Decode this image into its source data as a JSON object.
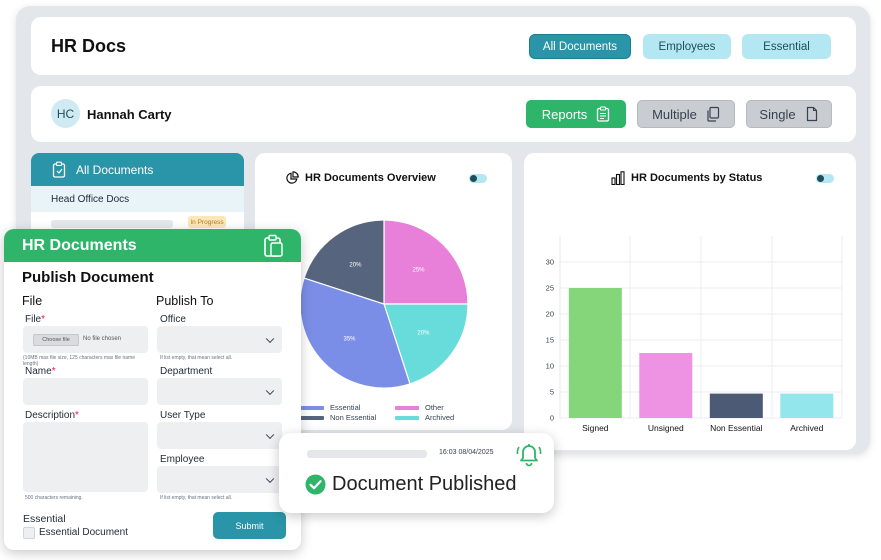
{
  "header": {
    "title": "HR Docs",
    "filters": [
      {
        "label": "All Documents",
        "active": true
      },
      {
        "label": "Employees",
        "active": false
      },
      {
        "label": "Essential",
        "active": false
      }
    ]
  },
  "user": {
    "initials": "HC",
    "name": "Hannah Carty",
    "buttons": {
      "reports": "Reports",
      "multiple": "Multiple",
      "single": "Single"
    }
  },
  "docs_panel": {
    "header": "All Documents",
    "item": "Head Office Docs",
    "badge": "In Progress"
  },
  "overview": {
    "title": "HR Documents Overview",
    "legend": [
      {
        "label": "Essential",
        "color": "#7a8ee8"
      },
      {
        "label": "Other",
        "color": "#e880da"
      },
      {
        "label": "Non Essential",
        "color": "#56647e"
      },
      {
        "label": "Archived",
        "color": "#68dcda"
      }
    ]
  },
  "status_chart": {
    "title": "HR Documents by Status"
  },
  "form": {
    "header": "HR Documents",
    "subtitle": "Publish Document",
    "file_heading": "File",
    "publish_heading": "Publish To",
    "file_label": "File",
    "choose_file": "Choose file",
    "no_file": "No file chosen",
    "file_hint": "(10MB max file size, 125 characters max file name length)",
    "name_label": "Name",
    "description_label": "Description",
    "desc_hint": "500 characters remaining.",
    "office_label": "Office",
    "office_hint": "If list empty, that mean select all.",
    "department_label": "Department",
    "user_type_label": "User Type",
    "employee_label": "Employee",
    "employee_hint": "If list empty, that mean select all.",
    "essential_label": "Essential",
    "essential_checkbox": "Essential Document",
    "submit": "Submit"
  },
  "toast": {
    "time": "16:03 08/04/2025",
    "message": "Document Published"
  },
  "chart_data": [
    {
      "type": "pie",
      "title": "HR Documents Overview",
      "categories": [
        "Other",
        "Archived",
        "Essential",
        "Non Essential"
      ],
      "values": [
        25,
        20,
        35,
        20
      ],
      "labels": [
        "25%",
        "20%",
        "35%",
        "20%"
      ],
      "colors": [
        "#e880da",
        "#68dcda",
        "#7a8ee8",
        "#56647e"
      ]
    },
    {
      "type": "bar",
      "title": "HR Documents by Status",
      "categories": [
        "Signed",
        "Unsigned",
        "Non Essential",
        "Archived"
      ],
      "values": [
        25,
        12.5,
        4.7,
        4.7
      ],
      "colors": [
        "#85d67a",
        "#ee92e4",
        "#4d5a75",
        "#93e7ec"
      ],
      "yticks": [
        0,
        5,
        10,
        15,
        20,
        25,
        30
      ],
      "ylim": [
        0,
        35
      ],
      "grid": true
    }
  ]
}
